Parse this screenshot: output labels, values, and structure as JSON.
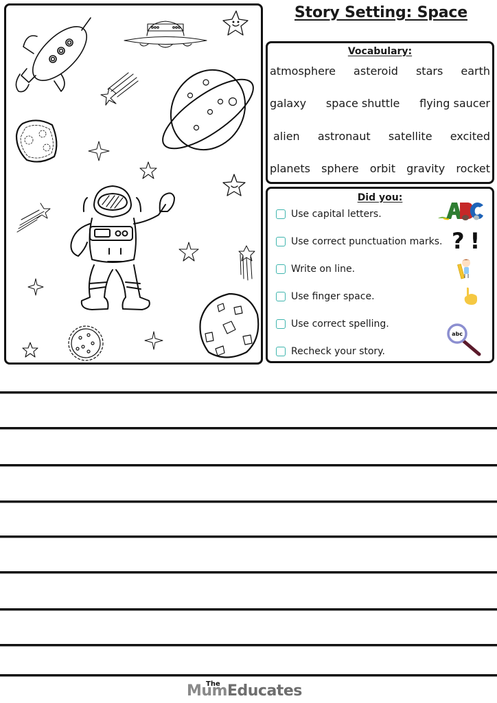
{
  "title": "Story Setting: Space",
  "vocabulary": {
    "heading": "Vocabulary:",
    "rows": [
      [
        "atmosphere",
        "asteroid",
        "stars",
        "earth"
      ],
      [
        "galaxy",
        "space shuttle",
        "flying saucer"
      ],
      [
        "alien",
        "astronaut",
        "satellite",
        "excited"
      ],
      [
        "planets",
        "sphere",
        "orbit",
        "gravity",
        "rocket"
      ]
    ]
  },
  "checklist": {
    "heading": "Did you:",
    "items": [
      {
        "label": "Use capital letters.",
        "icon": "abc-letters-icon",
        "checked": false
      },
      {
        "label": "Use correct punctuation marks.",
        "icon": "question-exclamation-icon",
        "checked": false
      },
      {
        "label": "Write on line.",
        "icon": "child-ruler-icon",
        "checked": false
      },
      {
        "label": "Use finger space.",
        "icon": "pointing-finger-icon",
        "checked": false
      },
      {
        "label": "Use correct spelling.",
        "icon": "magnifier-abc-icon",
        "checked": false
      },
      {
        "label": "Recheck your story.",
        "icon": "",
        "checked": false
      }
    ],
    "accent": "#3fb5ae"
  },
  "picture": {
    "elements": [
      "rocket",
      "flying saucer",
      "smiling star",
      "shooting star",
      "ringed planet",
      "asteroid",
      "sparkle stars",
      "astronaut",
      "cratered moon",
      "spiky planet"
    ]
  },
  "writing_lines": 9,
  "footer": {
    "logo_the": "The",
    "logo_mum": "Mum",
    "logo_educates": "Educates"
  }
}
